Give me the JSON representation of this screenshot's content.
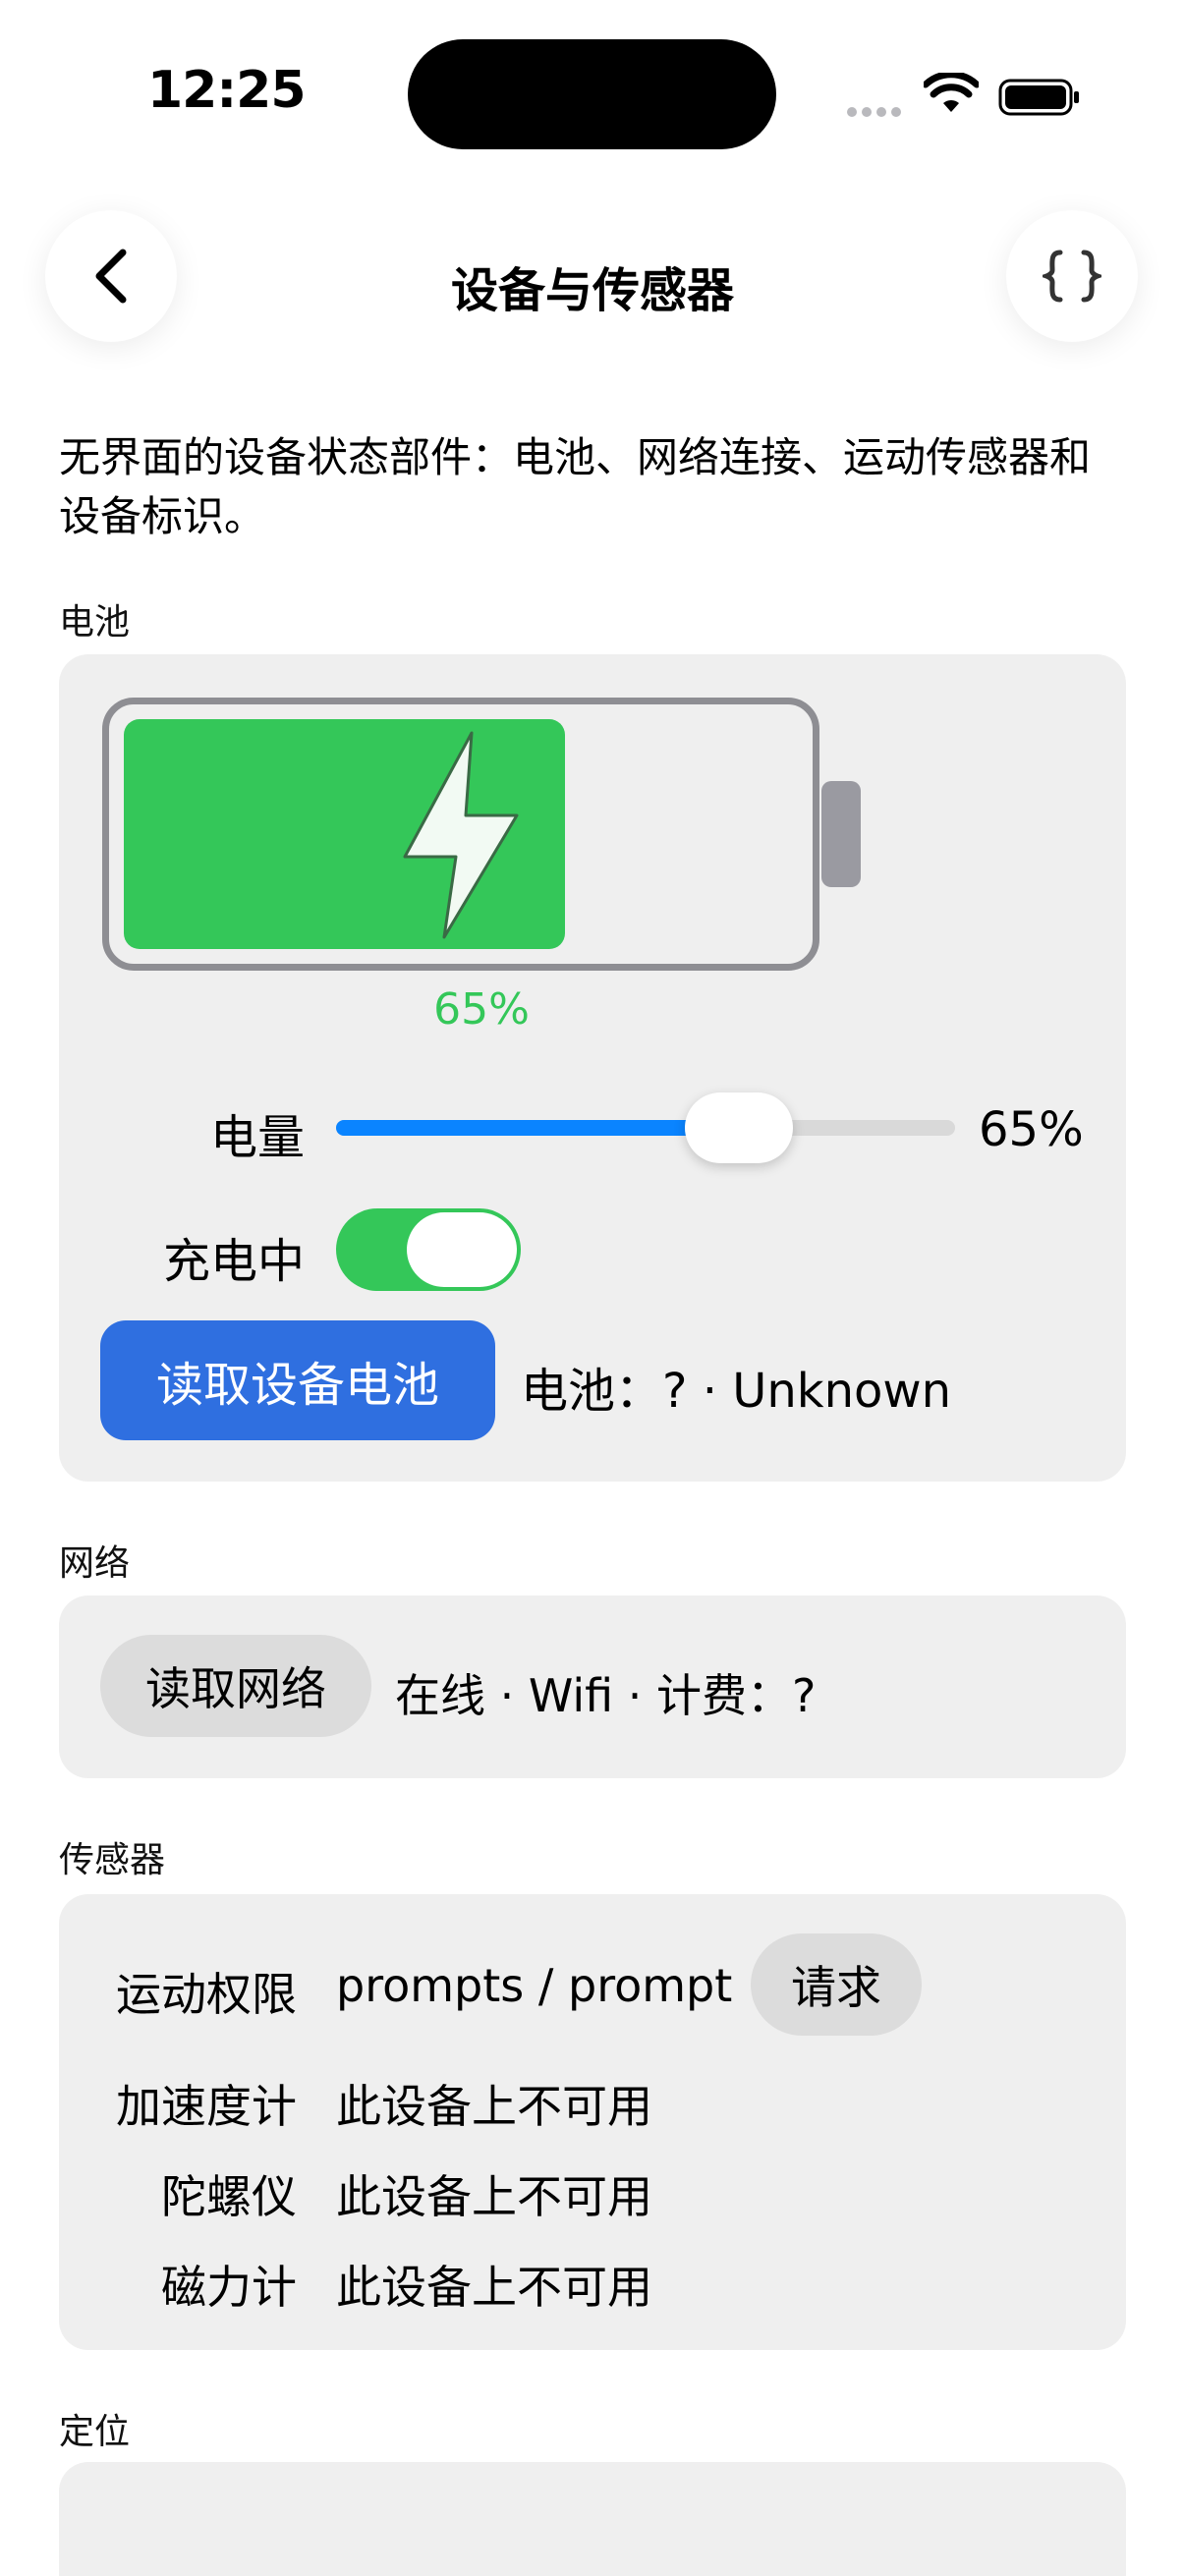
{
  "status_bar": {
    "time": "12:25"
  },
  "nav": {
    "title": "设备与传感器"
  },
  "intro": "无界面的设备状态部件：电池、网络连接、运动传感器和设备标识。",
  "battery": {
    "section_label": "电池",
    "level_percent": 65,
    "level_text": "65%",
    "charging_label": "电量",
    "slider_value_text": "65%",
    "toggle_label": "充电中",
    "toggle_on": true,
    "read_button": "读取设备电池",
    "status": "电池：? · Unknown",
    "colors": {
      "fill": "#34c759",
      "slider": "#0a84ff",
      "button": "#2f6fe0"
    }
  },
  "network": {
    "section_label": "网络",
    "read_button": "读取网络",
    "status": "在线 · Wifi · 计费：?"
  },
  "sensors": {
    "section_label": "传感器",
    "motion_label": "运动权限",
    "motion_value": "prompts / prompt",
    "request_button": "请求",
    "rows": [
      {
        "label": "加速度计",
        "value": "此设备上不可用"
      },
      {
        "label": "陀螺仪",
        "value": "此设备上不可用"
      },
      {
        "label": "磁力计",
        "value": "此设备上不可用"
      }
    ]
  },
  "location": {
    "section_label": "定位"
  },
  "icons": [
    "chevron-left-icon",
    "braces-icon",
    "wifi-icon",
    "battery-icon",
    "bolt-icon"
  ]
}
